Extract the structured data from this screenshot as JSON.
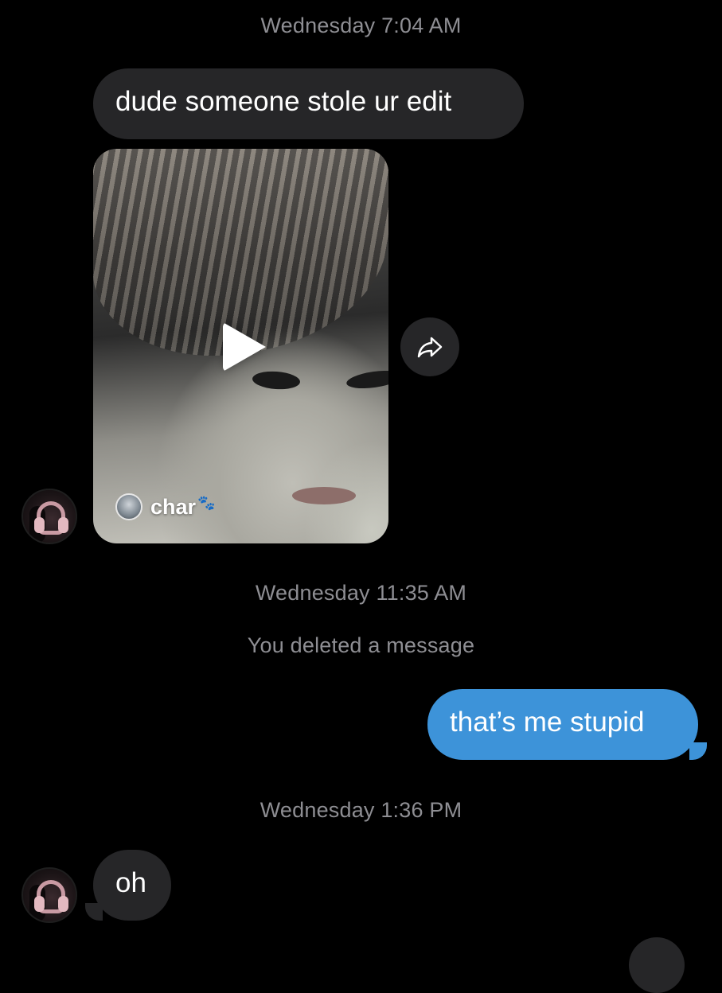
{
  "thread": {
    "timestamp_1": "Wednesday 7:04 AM",
    "msg_1": "dude someone stole ur edit",
    "shared_video": {
      "creator_name": "char",
      "creator_emoji": "🐾"
    },
    "timestamp_2": "Wednesday 11:35 AM",
    "deleted_notice": "You deleted a message",
    "msg_2": "that’s me stupid",
    "timestamp_3": "Wednesday 1:36 PM",
    "msg_3": "oh"
  },
  "icons": {
    "play": "play-icon",
    "share": "share-arrow-icon"
  },
  "colors": {
    "background": "#000000",
    "incoming_bubble": "#262628",
    "outgoing_bubble": "#3d93d9",
    "timestamp_text": "#8e8e93"
  }
}
